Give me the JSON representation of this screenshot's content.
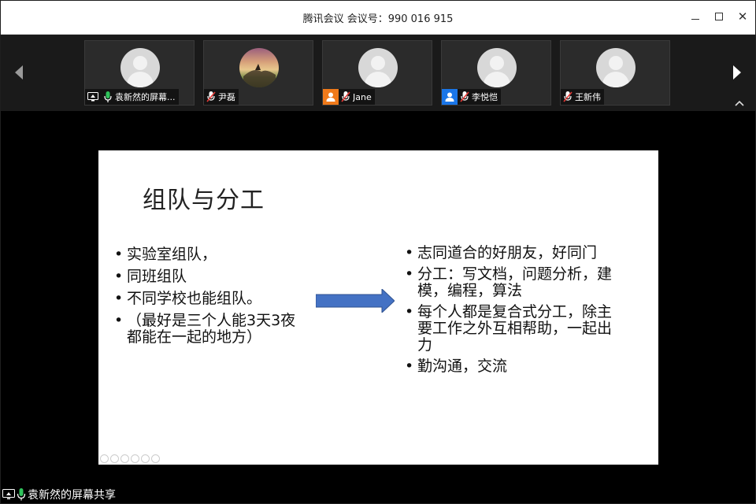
{
  "window": {
    "title": "腾讯会议 会议号：990 016 915",
    "minimize_icon": "minimize-icon",
    "maximize_icon": "maximize-icon",
    "close_icon": "close-icon"
  },
  "participants": [
    {
      "name": "袁新然的屏幕...",
      "badge": "screen-share-icon",
      "mic": "mic-on-icon",
      "avatar": "default"
    },
    {
      "name": "尹磊",
      "badge": "",
      "mic": "mic-muted-icon",
      "avatar": "photo"
    },
    {
      "name": "Jane",
      "badge": "user-orange-icon",
      "mic": "mic-muted-icon",
      "avatar": "default"
    },
    {
      "name": "李悦恺",
      "badge": "user-blue-icon",
      "mic": "mic-muted-icon",
      "avatar": "default"
    },
    {
      "name": "王新伟",
      "badge": "",
      "mic": "mic-muted-icon",
      "avatar": "default"
    }
  ],
  "slide": {
    "title": "组队与分工",
    "left_bullets": [
      "实验室组队，",
      "同班组队",
      "不同学校也能组队。",
      "（最好是三个人能3天3夜都能在一起的地方）"
    ],
    "right_bullets": [
      "志同道合的好朋友，好同门",
      "分工：写文档，问题分析，建模，编程，算法",
      "每个人都是复合式分工，除主要工作之外互相帮助，一起出力",
      "勤沟通，交流"
    ],
    "bullet_char": "•"
  },
  "share_status": {
    "label": "袁新然的屏幕共享"
  },
  "colors": {
    "arrow_fill": "#4472c4",
    "orange_badge": "#f07a1a",
    "blue_badge": "#1a76e8",
    "mic_green": "#2fc25b"
  }
}
